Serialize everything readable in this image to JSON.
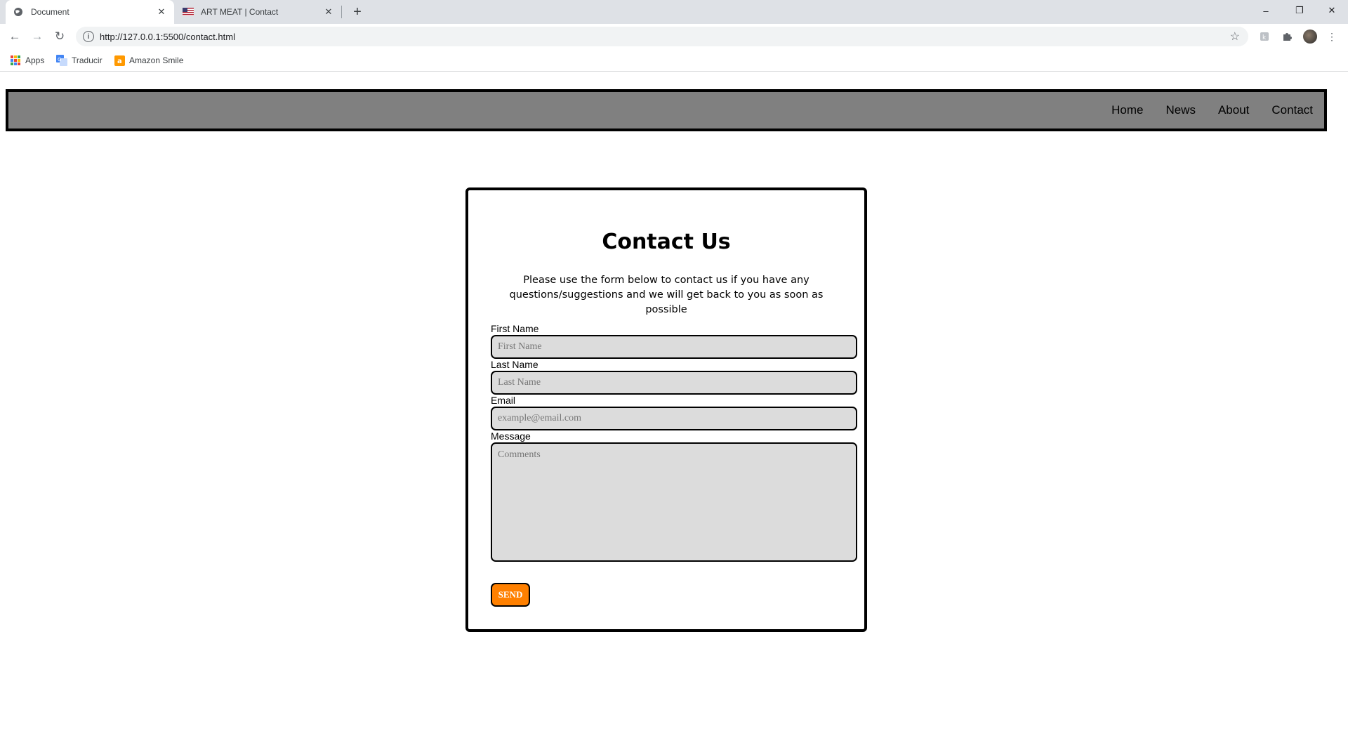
{
  "browser": {
    "tabs": [
      {
        "title": "Document",
        "active": true
      },
      {
        "title": "ART MEAT | Contact",
        "active": false
      }
    ],
    "url": "http://127.0.0.1:5500/contact.html",
    "bookmarks": [
      "Apps",
      "Traducir",
      "Amazon Smile"
    ],
    "window_controls": {
      "minimize": "–",
      "restore": "❐",
      "close": "✕"
    }
  },
  "nav": {
    "links": [
      "Home",
      "News",
      "About",
      "Contact"
    ]
  },
  "contact": {
    "title": "Contact Us",
    "intro": "Please use the form below to contact us if you have any questions/suggestions and we will get back to you as soon as possible",
    "fields": {
      "first_name": {
        "label": "First Name",
        "placeholder": "First Name",
        "value": ""
      },
      "last_name": {
        "label": "Last Name",
        "placeholder": "Last Name",
        "value": ""
      },
      "email": {
        "label": "Email",
        "placeholder": "example@email.com",
        "value": ""
      },
      "message": {
        "label": "Message",
        "placeholder": "Comments",
        "value": ""
      }
    },
    "submit_label": "SEND"
  },
  "colors": {
    "navbar_bg": "#808080",
    "field_bg": "#dcdcdc",
    "button_bg": "#ff8000",
    "tabstrip_bg": "#dee1e6"
  }
}
